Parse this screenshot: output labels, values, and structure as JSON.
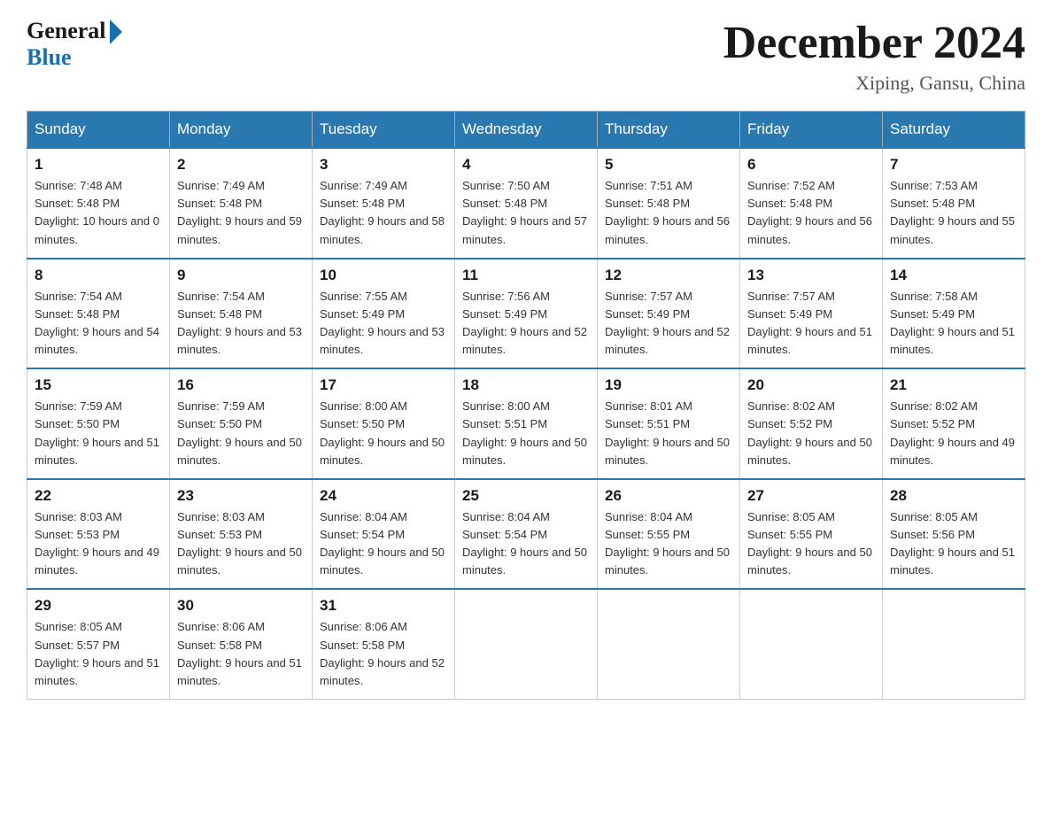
{
  "logo": {
    "general": "General",
    "blue": "Blue"
  },
  "header": {
    "month": "December 2024",
    "location": "Xiping, Gansu, China"
  },
  "weekdays": [
    "Sunday",
    "Monday",
    "Tuesday",
    "Wednesday",
    "Thursday",
    "Friday",
    "Saturday"
  ],
  "weeks": [
    [
      {
        "day": 1,
        "sunrise": "7:48 AM",
        "sunset": "5:48 PM",
        "daylight": "10 hours and 0 minutes."
      },
      {
        "day": 2,
        "sunrise": "7:49 AM",
        "sunset": "5:48 PM",
        "daylight": "9 hours and 59 minutes."
      },
      {
        "day": 3,
        "sunrise": "7:49 AM",
        "sunset": "5:48 PM",
        "daylight": "9 hours and 58 minutes."
      },
      {
        "day": 4,
        "sunrise": "7:50 AM",
        "sunset": "5:48 PM",
        "daylight": "9 hours and 57 minutes."
      },
      {
        "day": 5,
        "sunrise": "7:51 AM",
        "sunset": "5:48 PM",
        "daylight": "9 hours and 56 minutes."
      },
      {
        "day": 6,
        "sunrise": "7:52 AM",
        "sunset": "5:48 PM",
        "daylight": "9 hours and 56 minutes."
      },
      {
        "day": 7,
        "sunrise": "7:53 AM",
        "sunset": "5:48 PM",
        "daylight": "9 hours and 55 minutes."
      }
    ],
    [
      {
        "day": 8,
        "sunrise": "7:54 AM",
        "sunset": "5:48 PM",
        "daylight": "9 hours and 54 minutes."
      },
      {
        "day": 9,
        "sunrise": "7:54 AM",
        "sunset": "5:48 PM",
        "daylight": "9 hours and 53 minutes."
      },
      {
        "day": 10,
        "sunrise": "7:55 AM",
        "sunset": "5:49 PM",
        "daylight": "9 hours and 53 minutes."
      },
      {
        "day": 11,
        "sunrise": "7:56 AM",
        "sunset": "5:49 PM",
        "daylight": "9 hours and 52 minutes."
      },
      {
        "day": 12,
        "sunrise": "7:57 AM",
        "sunset": "5:49 PM",
        "daylight": "9 hours and 52 minutes."
      },
      {
        "day": 13,
        "sunrise": "7:57 AM",
        "sunset": "5:49 PM",
        "daylight": "9 hours and 51 minutes."
      },
      {
        "day": 14,
        "sunrise": "7:58 AM",
        "sunset": "5:49 PM",
        "daylight": "9 hours and 51 minutes."
      }
    ],
    [
      {
        "day": 15,
        "sunrise": "7:59 AM",
        "sunset": "5:50 PM",
        "daylight": "9 hours and 51 minutes."
      },
      {
        "day": 16,
        "sunrise": "7:59 AM",
        "sunset": "5:50 PM",
        "daylight": "9 hours and 50 minutes."
      },
      {
        "day": 17,
        "sunrise": "8:00 AM",
        "sunset": "5:50 PM",
        "daylight": "9 hours and 50 minutes."
      },
      {
        "day": 18,
        "sunrise": "8:00 AM",
        "sunset": "5:51 PM",
        "daylight": "9 hours and 50 minutes."
      },
      {
        "day": 19,
        "sunrise": "8:01 AM",
        "sunset": "5:51 PM",
        "daylight": "9 hours and 50 minutes."
      },
      {
        "day": 20,
        "sunrise": "8:02 AM",
        "sunset": "5:52 PM",
        "daylight": "9 hours and 50 minutes."
      },
      {
        "day": 21,
        "sunrise": "8:02 AM",
        "sunset": "5:52 PM",
        "daylight": "9 hours and 49 minutes."
      }
    ],
    [
      {
        "day": 22,
        "sunrise": "8:03 AM",
        "sunset": "5:53 PM",
        "daylight": "9 hours and 49 minutes."
      },
      {
        "day": 23,
        "sunrise": "8:03 AM",
        "sunset": "5:53 PM",
        "daylight": "9 hours and 50 minutes."
      },
      {
        "day": 24,
        "sunrise": "8:04 AM",
        "sunset": "5:54 PM",
        "daylight": "9 hours and 50 minutes."
      },
      {
        "day": 25,
        "sunrise": "8:04 AM",
        "sunset": "5:54 PM",
        "daylight": "9 hours and 50 minutes."
      },
      {
        "day": 26,
        "sunrise": "8:04 AM",
        "sunset": "5:55 PM",
        "daylight": "9 hours and 50 minutes."
      },
      {
        "day": 27,
        "sunrise": "8:05 AM",
        "sunset": "5:55 PM",
        "daylight": "9 hours and 50 minutes."
      },
      {
        "day": 28,
        "sunrise": "8:05 AM",
        "sunset": "5:56 PM",
        "daylight": "9 hours and 51 minutes."
      }
    ],
    [
      {
        "day": 29,
        "sunrise": "8:05 AM",
        "sunset": "5:57 PM",
        "daylight": "9 hours and 51 minutes."
      },
      {
        "day": 30,
        "sunrise": "8:06 AM",
        "sunset": "5:58 PM",
        "daylight": "9 hours and 51 minutes."
      },
      {
        "day": 31,
        "sunrise": "8:06 AM",
        "sunset": "5:58 PM",
        "daylight": "9 hours and 52 minutes."
      },
      null,
      null,
      null,
      null
    ]
  ]
}
